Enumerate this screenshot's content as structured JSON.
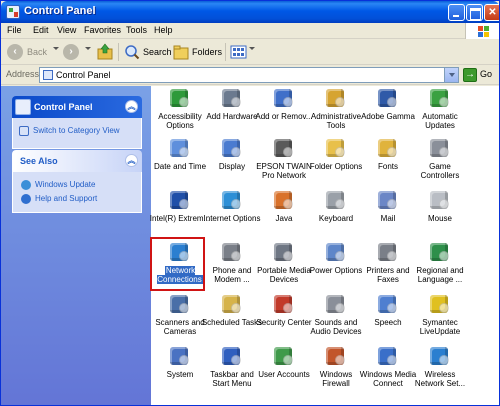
{
  "window": {
    "title": "Control Panel",
    "buttons": {
      "minimize": "",
      "maximize": "",
      "close": "✕"
    }
  },
  "menu": [
    "File",
    "Edit",
    "View",
    "Favorites",
    "Tools",
    "Help"
  ],
  "toolbar": {
    "back": "Back",
    "search": "Search",
    "folders": "Folders"
  },
  "address": {
    "label": "Address",
    "value": "Control Panel",
    "go": "Go"
  },
  "sidebar": {
    "panel1": {
      "title": "Control Panel",
      "links": [
        "Switch to Category View"
      ]
    },
    "panel2": {
      "title": "See Also",
      "links": [
        "Windows Update",
        "Help and Support"
      ]
    }
  },
  "items": [
    {
      "label": "Accessibility Options",
      "icon": "accessibility-icon",
      "color": "#2e9a3a"
    },
    {
      "label": "Add Hardware",
      "icon": "add-hardware-icon",
      "color": "#6b7a8f"
    },
    {
      "label": "Add or Remov...",
      "icon": "add-remove-programs-icon",
      "color": "#3f6fc9"
    },
    {
      "label": "Administrative Tools",
      "icon": "administrative-tools-icon",
      "color": "#d6a431"
    },
    {
      "label": "Adobe Gamma",
      "icon": "adobe-gamma-icon",
      "color": "#2f5aa8"
    },
    {
      "label": "Automatic Updates",
      "icon": "automatic-updates-icon",
      "color": "#3aa141"
    },
    {
      "label": "Date and Time",
      "icon": "date-time-icon",
      "color": "#5f8fdc"
    },
    {
      "label": "Display",
      "icon": "display-icon",
      "color": "#4a7bd0"
    },
    {
      "label": "EPSON TWAIN Pro Network",
      "icon": "epson-twain-icon",
      "color": "#5a5a5a"
    },
    {
      "label": "Folder Options",
      "icon": "folder-options-icon",
      "color": "#e8c04a"
    },
    {
      "label": "Fonts",
      "icon": "fonts-icon",
      "color": "#e0b33c"
    },
    {
      "label": "Game Controllers",
      "icon": "game-controllers-icon",
      "color": "#8a8f99"
    },
    {
      "label": "Intel(R) Extrem...",
      "icon": "intel-graphics-icon",
      "color": "#1f4fa8"
    },
    {
      "label": "Internet Options",
      "icon": "internet-options-icon",
      "color": "#2d8fd6"
    },
    {
      "label": "Java",
      "icon": "java-icon",
      "color": "#d9722b"
    },
    {
      "label": "Keyboard",
      "icon": "keyboard-icon",
      "color": "#9aa0a8"
    },
    {
      "label": "Mail",
      "icon": "mail-icon",
      "color": "#6b86c6"
    },
    {
      "label": "Mouse",
      "icon": "mouse-icon",
      "color": "#b9bdc4"
    },
    {
      "label": "Network Connections",
      "icon": "network-connections-icon",
      "color": "#2b7fd0"
    },
    {
      "label": "Phone and Modem ...",
      "icon": "phone-modem-icon",
      "color": "#7a7f88"
    },
    {
      "label": "Portable Media Devices",
      "icon": "portable-media-icon",
      "color": "#6f7784"
    },
    {
      "label": "Power Options",
      "icon": "power-options-icon",
      "color": "#5e86c9"
    },
    {
      "label": "Printers and Faxes",
      "icon": "printers-faxes-icon",
      "color": "#7a7f88"
    },
    {
      "label": "Regional and Language ...",
      "icon": "regional-language-icon",
      "color": "#2e8f4a"
    },
    {
      "label": "Scanners and Cameras",
      "icon": "scanners-cameras-icon",
      "color": "#4a6fa8"
    },
    {
      "label": "Scheduled Tasks",
      "icon": "scheduled-tasks-icon",
      "color": "#d6b34a"
    },
    {
      "label": "Security Center",
      "icon": "security-center-icon",
      "color": "#c23a2a"
    },
    {
      "label": "Sounds and Audio Devices",
      "icon": "sounds-audio-icon",
      "color": "#8a8f99"
    },
    {
      "label": "Speech",
      "icon": "speech-icon",
      "color": "#4f7fd0"
    },
    {
      "label": "Symantec LiveUpdate",
      "icon": "symantec-liveupdate-icon",
      "color": "#e0c020"
    },
    {
      "label": "System",
      "icon": "system-icon",
      "color": "#4a72c2"
    },
    {
      "label": "Taskbar and Start Menu",
      "icon": "taskbar-start-icon",
      "color": "#2f5fbf"
    },
    {
      "label": "User Accounts",
      "icon": "user-accounts-icon",
      "color": "#3f9a4a"
    },
    {
      "label": "Windows Firewall",
      "icon": "windows-firewall-icon",
      "color": "#c2552a"
    },
    {
      "label": "Windows Media Connect",
      "icon": "windows-media-connect-icon",
      "color": "#3a6fc9"
    },
    {
      "label": "Wireless Network Set...",
      "icon": "wireless-network-icon",
      "color": "#2b7fd0"
    }
  ],
  "selected_item": "Network Connections"
}
